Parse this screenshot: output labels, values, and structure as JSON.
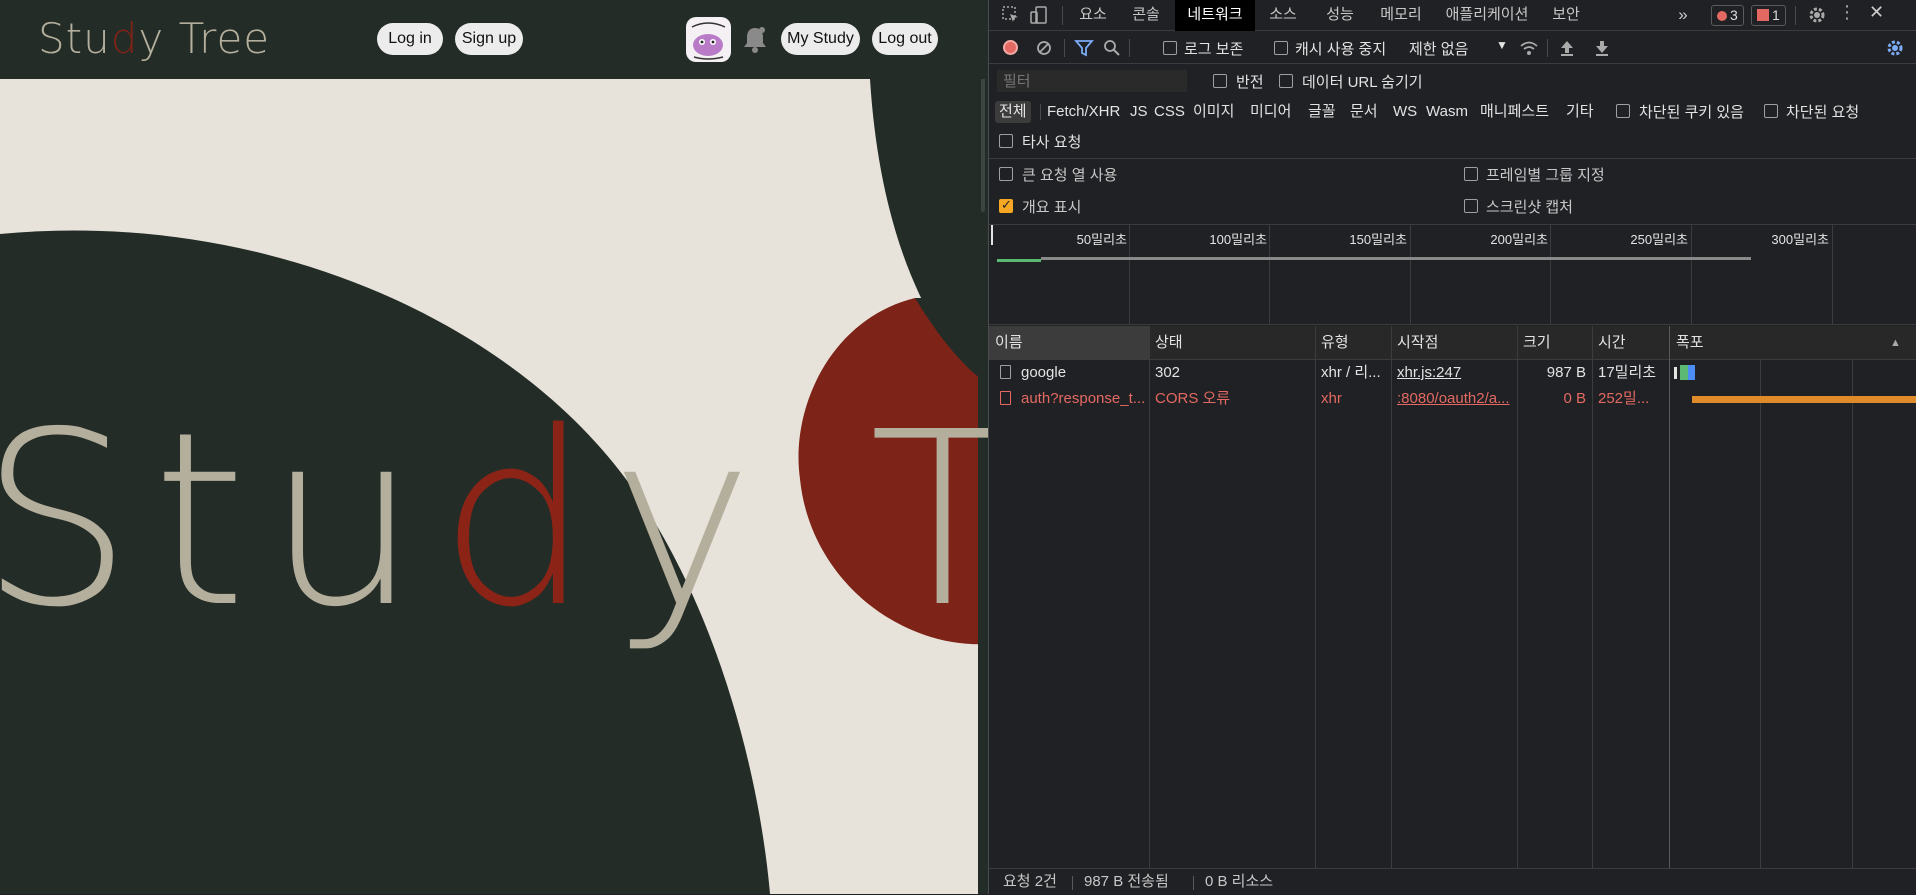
{
  "site": {
    "logo": {
      "pre": "Stu",
      "hl": "d",
      "post": "y Tree"
    },
    "nav": {
      "login": "Log in",
      "signup": "Sign up",
      "my_study": "My Study",
      "logout": "Log out"
    },
    "hero": {
      "pre": "Stu",
      "hl": "d",
      "post": "y Tree"
    },
    "colors": {
      "dark": "#232c27",
      "cream": "#e8e3da",
      "red": "#8b2416",
      "beige": "#b4ae9c"
    }
  },
  "devtools": {
    "tabs": [
      "요소",
      "콘솔",
      "네트워크",
      "소스",
      "성능",
      "메모리",
      "애플리케이션",
      "보안"
    ],
    "active_tab": "네트워크",
    "more_tabs": "»",
    "errors_count": "3",
    "issues_count": "1",
    "toolbar": {
      "preserve_log": "로그 보존",
      "disable_cache": "캐시 사용 중지",
      "throttle": "제한 없음"
    },
    "filter": {
      "placeholder": "필터",
      "invert": "반전",
      "hide_data_url": "데이터 URL 숨기기"
    },
    "types": [
      "전체",
      "Fetch/XHR",
      "JS",
      "CSS",
      "이미지",
      "미디어",
      "글꼴",
      "문서",
      "WS",
      "Wasm",
      "매니페스트",
      "기타"
    ],
    "blocked_cookies": "차단된 쿠키 있음",
    "blocked_requests": "차단된 요청",
    "third_party": "타사 요청",
    "options": {
      "large_rows": "큰 요청 열 사용",
      "group_by_frame": "프레임별 그룹 지정",
      "overview": "개요 표시",
      "screenshots": "스크린샷 캡처"
    },
    "timeline_labels": [
      "50밀리초",
      "100밀리초",
      "150밀리초",
      "200밀리초",
      "250밀리초",
      "300밀리초"
    ],
    "columns": [
      "이름",
      "상태",
      "유형",
      "시작점",
      "크기",
      "시간",
      "폭포"
    ],
    "rows": [
      {
        "name": "google",
        "status": "302",
        "type": "xhr / 리...",
        "initiator": "xhr.js:247",
        "size": "987 B",
        "time": "17밀리초"
      },
      {
        "name": "auth?response_t...",
        "status": "CORS 오류",
        "type": "xhr",
        "initiator": ":8080/oauth2/a...",
        "size": "0 B",
        "time": "252밀..."
      }
    ],
    "status": {
      "requests": "요청 2건",
      "transferred": "987 B 전송됨",
      "resources": "0 B 리소스"
    }
  }
}
